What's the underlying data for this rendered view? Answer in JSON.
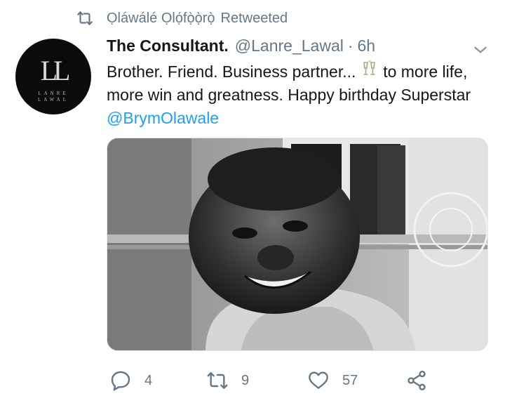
{
  "retweet_banner": {
    "icon": "retweet-icon",
    "retweeter": "Ọláwálé Ọlọ́fọ̀ọ̀rọ̀",
    "label": "Retweeted"
  },
  "tweet": {
    "avatar": {
      "monogram": "LL",
      "line1": "LANRE",
      "line2": "LAWAL"
    },
    "display_name": "The Consultant.",
    "handle": "@Lanre_Lawal",
    "separator": "·",
    "time": "6h",
    "text": {
      "part1": "Brother. Friend. Business partner...",
      "emoji": "champagne-glasses-emoji",
      "part2": "to more life, more win and greatness. Happy birthday Superstar",
      "mention": "@BrymOlawale"
    },
    "media": {
      "type": "photo",
      "description_icon": "photo-smiling-man"
    },
    "actions": {
      "reply_count": "4",
      "retweet_count": "9",
      "like_count": "57"
    }
  },
  "colors": {
    "text_primary": "#14171a",
    "text_secondary": "#657786",
    "link": "#1da1f2",
    "border": "#e1e8ed"
  }
}
